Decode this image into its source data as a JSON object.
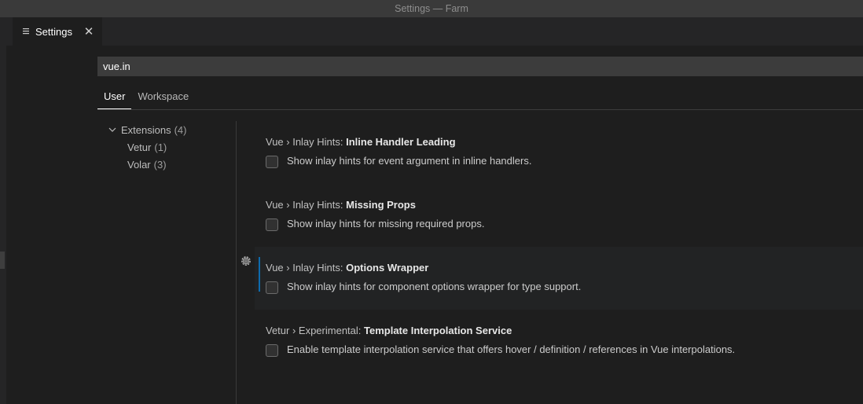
{
  "window": {
    "title": "Settings — Farm"
  },
  "tab": {
    "label": "Settings",
    "icon": "hamburger-icon",
    "close_icon": "close-icon"
  },
  "search": {
    "value": "vue.in"
  },
  "scope_tabs": [
    {
      "label": "User",
      "active": true
    },
    {
      "label": "Workspace",
      "active": false
    }
  ],
  "toc": {
    "group": {
      "label": "Extensions",
      "count": "(4)",
      "icon": "chevron-down-icon"
    },
    "items": [
      {
        "label": "Vetur",
        "count": "(1)"
      },
      {
        "label": "Volar",
        "count": "(3)"
      }
    ]
  },
  "settings": [
    {
      "category": "Vue › Inlay Hints: ",
      "name": "Inline Handler Leading",
      "description": "Show inlay hints for event argument in inline handlers.",
      "checked": false
    },
    {
      "category": "Vue › Inlay Hints: ",
      "name": "Missing Props",
      "description": "Show inlay hints for missing required props.",
      "checked": false
    },
    {
      "category": "Vue › Inlay Hints: ",
      "name": "Options Wrapper",
      "description": "Show inlay hints for component options wrapper for type support.",
      "checked": false,
      "focused": true
    },
    {
      "category": "Vetur › Experimental: ",
      "name": "Template Interpolation Service",
      "description": "Enable template interpolation service that offers hover / definition / references in Vue interpolations.",
      "checked": false
    }
  ],
  "colors": {
    "accent": "#0e6bad",
    "background": "#1e1e1e",
    "input_background": "#3c3c3c"
  }
}
